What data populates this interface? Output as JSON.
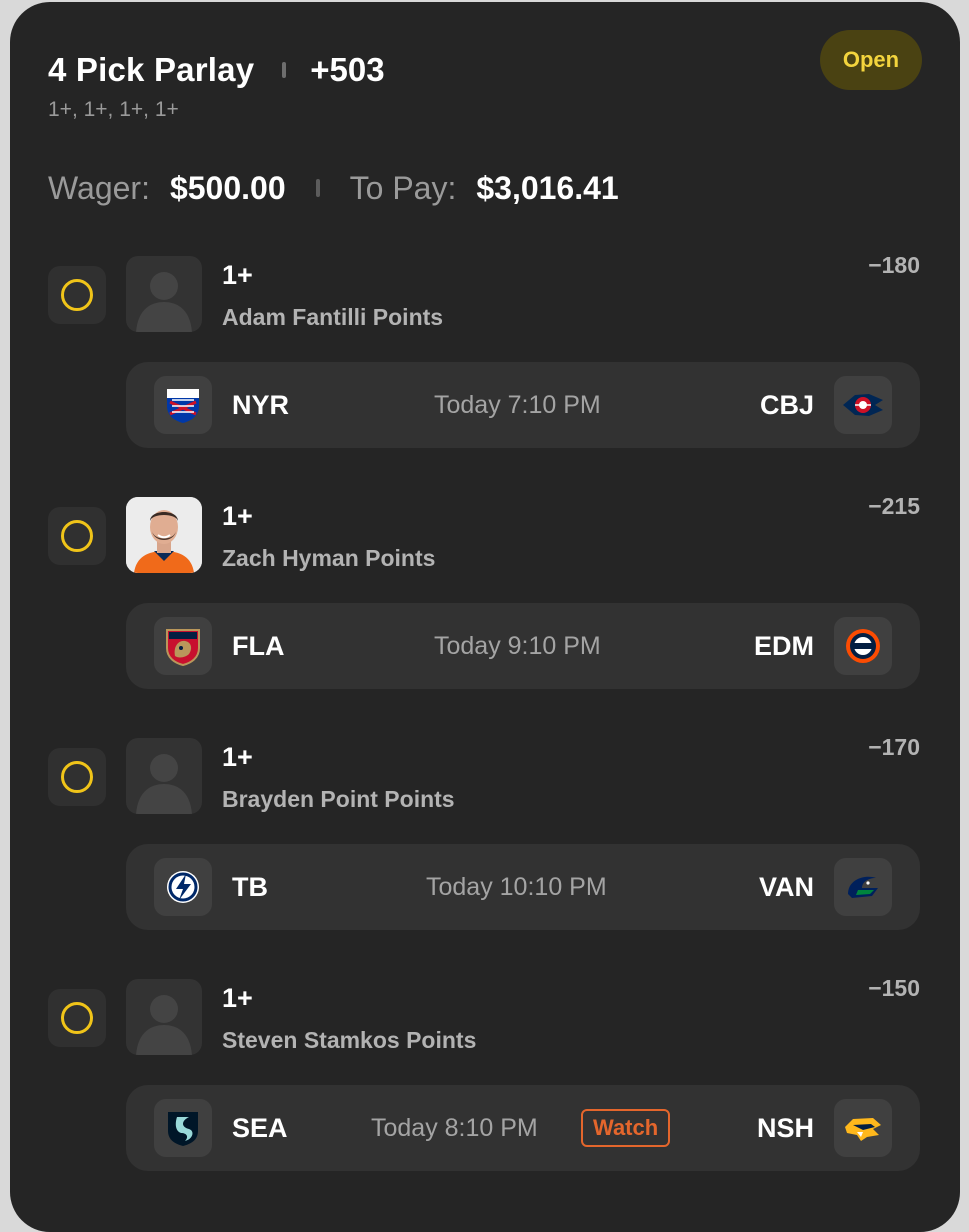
{
  "parlay": {
    "title": "4 Pick Parlay",
    "odds": "+503",
    "lines_summary": "1+, 1+, 1+, 1+",
    "status": "Open",
    "wager_label": "Wager:",
    "wager_value": "$500.00",
    "to_pay_label": "To Pay:",
    "to_pay_value": "$3,016.41"
  },
  "picks": [
    {
      "line": "1+",
      "player": "Adam Fantilli Points",
      "odds": "−180",
      "avatar": "placeholder-avatar",
      "game": {
        "away": "NYR",
        "home": "CBJ",
        "time": "Today 7:10 PM",
        "away_logo": "rangers-logo-icon",
        "home_logo": "blue-jackets-logo-icon"
      }
    },
    {
      "line": "1+",
      "player": "Zach Hyman Points",
      "odds": "−215",
      "avatar": "player-photo",
      "game": {
        "away": "FLA",
        "home": "EDM",
        "time": "Today 9:10 PM",
        "away_logo": "panthers-logo-icon",
        "home_logo": "oilers-logo-icon"
      }
    },
    {
      "line": "1+",
      "player": "Brayden Point Points",
      "odds": "−170",
      "avatar": "placeholder-avatar",
      "game": {
        "away": "TB",
        "home": "VAN",
        "time": "Today 10:10 PM",
        "away_logo": "lightning-logo-icon",
        "home_logo": "canucks-logo-icon"
      }
    },
    {
      "line": "1+",
      "player": "Steven Stamkos Points",
      "odds": "−150",
      "avatar": "placeholder-avatar",
      "game": {
        "away": "SEA",
        "home": "NSH",
        "time": "Today 8:10 PM",
        "watch_label": "Watch",
        "away_logo": "kraken-logo-icon",
        "home_logo": "predators-logo-icon"
      }
    }
  ],
  "colors": {
    "background": "#252525",
    "accent_yellow": "#f0c419",
    "watch_orange": "#e4662c"
  }
}
